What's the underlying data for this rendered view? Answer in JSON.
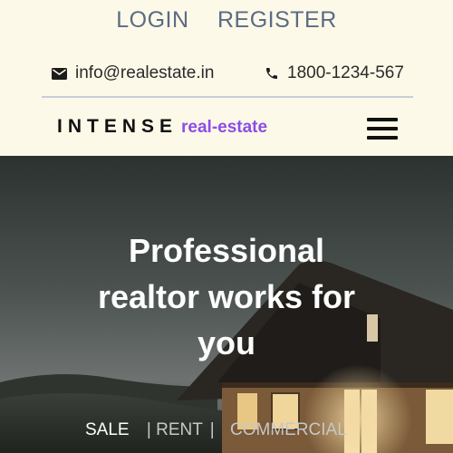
{
  "auth": {
    "login": "LOGIN",
    "register": "REGISTER"
  },
  "contact": {
    "email": "info@realestate.in",
    "phone": "1800-1234-567",
    "email_icon": "envelope-icon",
    "phone_icon": "phone-icon"
  },
  "brand": {
    "name": "INTENSE",
    "suffix": "real-estate",
    "suffix_color": "#8b4de8"
  },
  "menu": {
    "icon": "hamburger-menu-icon"
  },
  "hero": {
    "title_line1": "Professional",
    "title_line2": "realtor works for",
    "title_line3": "you"
  },
  "tabs": {
    "items": [
      {
        "label": "SALE",
        "active": true
      },
      {
        "label": "RENT",
        "active": false
      },
      {
        "label": "COMMERCIAL",
        "active": false
      }
    ],
    "separator": "|"
  },
  "colors": {
    "background": "#fdf9e8",
    "link": "#5a6b85",
    "accent": "#8b4de8"
  }
}
